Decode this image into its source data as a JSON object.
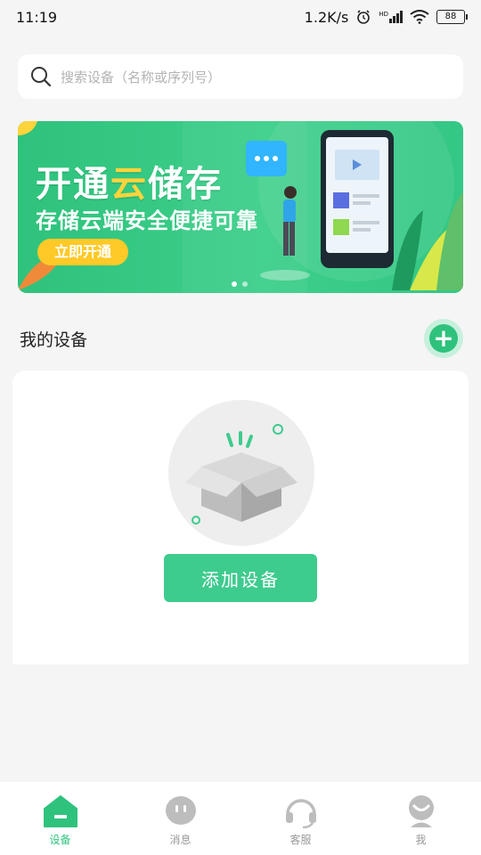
{
  "status_bar": {
    "time": "11:19",
    "network_speed": "1.2K/s",
    "signal_badge": "HD",
    "battery": "88"
  },
  "search": {
    "placeholder": "搜索设备（名称或序列号）"
  },
  "banner": {
    "title_part1": "开通",
    "title_highlight": "云",
    "title_part2": "储存",
    "subtitle": "存储云端安全便捷可靠",
    "button_label": "立即开通"
  },
  "my_devices": {
    "title": "我的设备",
    "add_button_label": "添加设备"
  },
  "tabs": [
    {
      "label": "设备",
      "icon": "home-icon",
      "active": true
    },
    {
      "label": "消息",
      "icon": "message-icon",
      "active": false
    },
    {
      "label": "客服",
      "icon": "headset-icon",
      "active": false
    },
    {
      "label": "我",
      "icon": "profile-icon",
      "active": false
    }
  ],
  "colors": {
    "accent": "#2fc27d",
    "highlight": "#ffd43b",
    "banner_button": "#ffc928",
    "inactive_tab": "#bdbdbd"
  }
}
